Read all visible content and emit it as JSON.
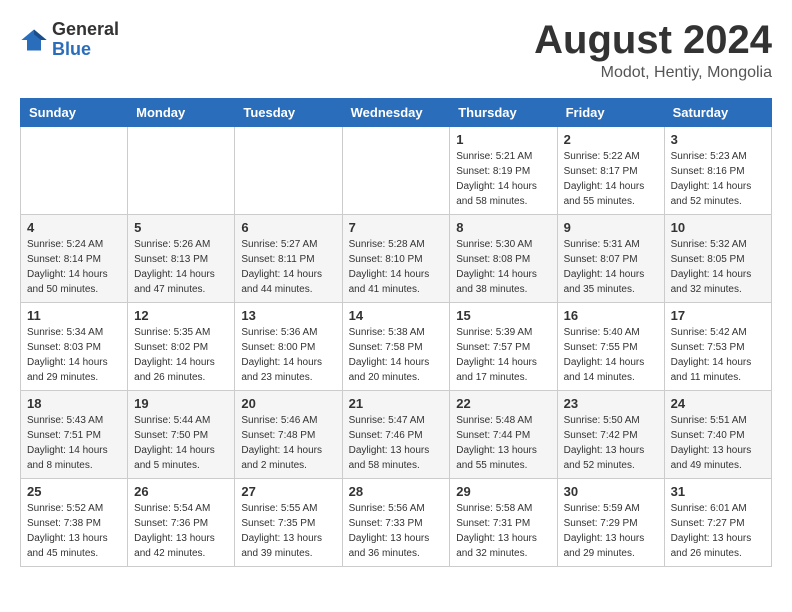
{
  "logo": {
    "general": "General",
    "blue": "Blue"
  },
  "header": {
    "month_year": "August 2024",
    "location": "Modot, Hentiy, Mongolia"
  },
  "weekdays": [
    "Sunday",
    "Monday",
    "Tuesday",
    "Wednesday",
    "Thursday",
    "Friday",
    "Saturday"
  ],
  "weeks": [
    [
      {
        "day": "",
        "info": ""
      },
      {
        "day": "",
        "info": ""
      },
      {
        "day": "",
        "info": ""
      },
      {
        "day": "",
        "info": ""
      },
      {
        "day": "1",
        "info": "Sunrise: 5:21 AM\nSunset: 8:19 PM\nDaylight: 14 hours\nand 58 minutes."
      },
      {
        "day": "2",
        "info": "Sunrise: 5:22 AM\nSunset: 8:17 PM\nDaylight: 14 hours\nand 55 minutes."
      },
      {
        "day": "3",
        "info": "Sunrise: 5:23 AM\nSunset: 8:16 PM\nDaylight: 14 hours\nand 52 minutes."
      }
    ],
    [
      {
        "day": "4",
        "info": "Sunrise: 5:24 AM\nSunset: 8:14 PM\nDaylight: 14 hours\nand 50 minutes."
      },
      {
        "day": "5",
        "info": "Sunrise: 5:26 AM\nSunset: 8:13 PM\nDaylight: 14 hours\nand 47 minutes."
      },
      {
        "day": "6",
        "info": "Sunrise: 5:27 AM\nSunset: 8:11 PM\nDaylight: 14 hours\nand 44 minutes."
      },
      {
        "day": "7",
        "info": "Sunrise: 5:28 AM\nSunset: 8:10 PM\nDaylight: 14 hours\nand 41 minutes."
      },
      {
        "day": "8",
        "info": "Sunrise: 5:30 AM\nSunset: 8:08 PM\nDaylight: 14 hours\nand 38 minutes."
      },
      {
        "day": "9",
        "info": "Sunrise: 5:31 AM\nSunset: 8:07 PM\nDaylight: 14 hours\nand 35 minutes."
      },
      {
        "day": "10",
        "info": "Sunrise: 5:32 AM\nSunset: 8:05 PM\nDaylight: 14 hours\nand 32 minutes."
      }
    ],
    [
      {
        "day": "11",
        "info": "Sunrise: 5:34 AM\nSunset: 8:03 PM\nDaylight: 14 hours\nand 29 minutes."
      },
      {
        "day": "12",
        "info": "Sunrise: 5:35 AM\nSunset: 8:02 PM\nDaylight: 14 hours\nand 26 minutes."
      },
      {
        "day": "13",
        "info": "Sunrise: 5:36 AM\nSunset: 8:00 PM\nDaylight: 14 hours\nand 23 minutes."
      },
      {
        "day": "14",
        "info": "Sunrise: 5:38 AM\nSunset: 7:58 PM\nDaylight: 14 hours\nand 20 minutes."
      },
      {
        "day": "15",
        "info": "Sunrise: 5:39 AM\nSunset: 7:57 PM\nDaylight: 14 hours\nand 17 minutes."
      },
      {
        "day": "16",
        "info": "Sunrise: 5:40 AM\nSunset: 7:55 PM\nDaylight: 14 hours\nand 14 minutes."
      },
      {
        "day": "17",
        "info": "Sunrise: 5:42 AM\nSunset: 7:53 PM\nDaylight: 14 hours\nand 11 minutes."
      }
    ],
    [
      {
        "day": "18",
        "info": "Sunrise: 5:43 AM\nSunset: 7:51 PM\nDaylight: 14 hours\nand 8 minutes."
      },
      {
        "day": "19",
        "info": "Sunrise: 5:44 AM\nSunset: 7:50 PM\nDaylight: 14 hours\nand 5 minutes."
      },
      {
        "day": "20",
        "info": "Sunrise: 5:46 AM\nSunset: 7:48 PM\nDaylight: 14 hours\nand 2 minutes."
      },
      {
        "day": "21",
        "info": "Sunrise: 5:47 AM\nSunset: 7:46 PM\nDaylight: 13 hours\nand 58 minutes."
      },
      {
        "day": "22",
        "info": "Sunrise: 5:48 AM\nSunset: 7:44 PM\nDaylight: 13 hours\nand 55 minutes."
      },
      {
        "day": "23",
        "info": "Sunrise: 5:50 AM\nSunset: 7:42 PM\nDaylight: 13 hours\nand 52 minutes."
      },
      {
        "day": "24",
        "info": "Sunrise: 5:51 AM\nSunset: 7:40 PM\nDaylight: 13 hours\nand 49 minutes."
      }
    ],
    [
      {
        "day": "25",
        "info": "Sunrise: 5:52 AM\nSunset: 7:38 PM\nDaylight: 13 hours\nand 45 minutes."
      },
      {
        "day": "26",
        "info": "Sunrise: 5:54 AM\nSunset: 7:36 PM\nDaylight: 13 hours\nand 42 minutes."
      },
      {
        "day": "27",
        "info": "Sunrise: 5:55 AM\nSunset: 7:35 PM\nDaylight: 13 hours\nand 39 minutes."
      },
      {
        "day": "28",
        "info": "Sunrise: 5:56 AM\nSunset: 7:33 PM\nDaylight: 13 hours\nand 36 minutes."
      },
      {
        "day": "29",
        "info": "Sunrise: 5:58 AM\nSunset: 7:31 PM\nDaylight: 13 hours\nand 32 minutes."
      },
      {
        "day": "30",
        "info": "Sunrise: 5:59 AM\nSunset: 7:29 PM\nDaylight: 13 hours\nand 29 minutes."
      },
      {
        "day": "31",
        "info": "Sunrise: 6:01 AM\nSunset: 7:27 PM\nDaylight: 13 hours\nand 26 minutes."
      }
    ]
  ]
}
